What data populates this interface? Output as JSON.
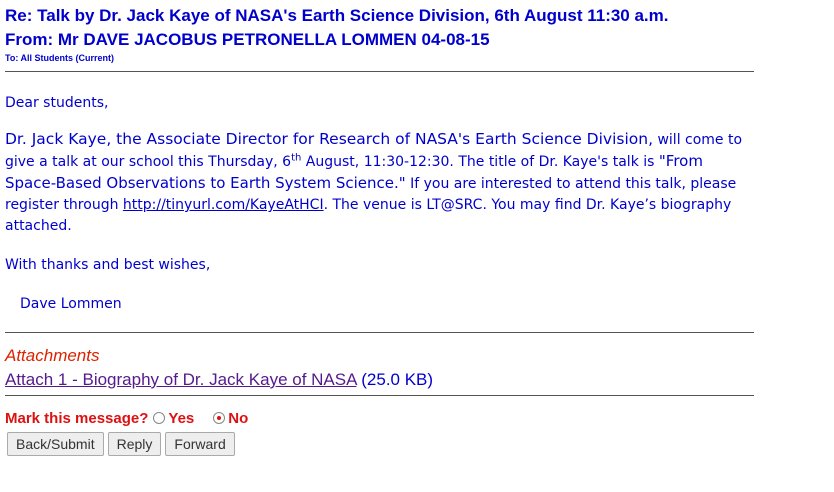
{
  "header": {
    "subject": "Re: Talk by Dr. Jack Kaye of NASA's Earth Science Division, 6th August 11:30 a.m.",
    "from": "From: Mr DAVE JACOBUS PETRONELLA LOMMEN 04-08-15",
    "to": "To: All Students (Current)"
  },
  "message": {
    "greeting": "Dear students,",
    "lead": "Dr. Jack Kaye, the Associate Director for Research of NASA's Earth Science Division,",
    "part1": " will come to give a talk at our school this Thursday, 6",
    "sup": "th",
    "part2": " August, 11:30-12:30. The title of Dr. Kaye's talk is ",
    "talk_title": "\"From Space-Based Observations to Earth System Science.\"",
    "part3": " If you are interested to attend this talk, please register through ",
    "link": "http://tinyurl.com/KayeAtHCI",
    "part4": ". The venue is LT@SRC. You may find Dr. Kaye’s biography attached.",
    "thanks": "With thanks and best wishes,",
    "signature": "Dave Lommen"
  },
  "attachments": {
    "heading": "Attachments",
    "items": [
      {
        "label": "Attach 1 - Biography of Dr. Jack Kaye of NASA",
        "size": "(25.0 KB)"
      }
    ]
  },
  "mark": {
    "label": "Mark this message?",
    "options": [
      "Yes",
      "No"
    ],
    "selected": "No"
  },
  "buttons": {
    "back": "Back/Submit",
    "reply": "Reply",
    "forward": "Forward"
  },
  "colors": {
    "text": "#0000cc",
    "attachment_heading": "#dd2200",
    "visited_link": "#551a8b",
    "mark_label": "#dd1111"
  }
}
